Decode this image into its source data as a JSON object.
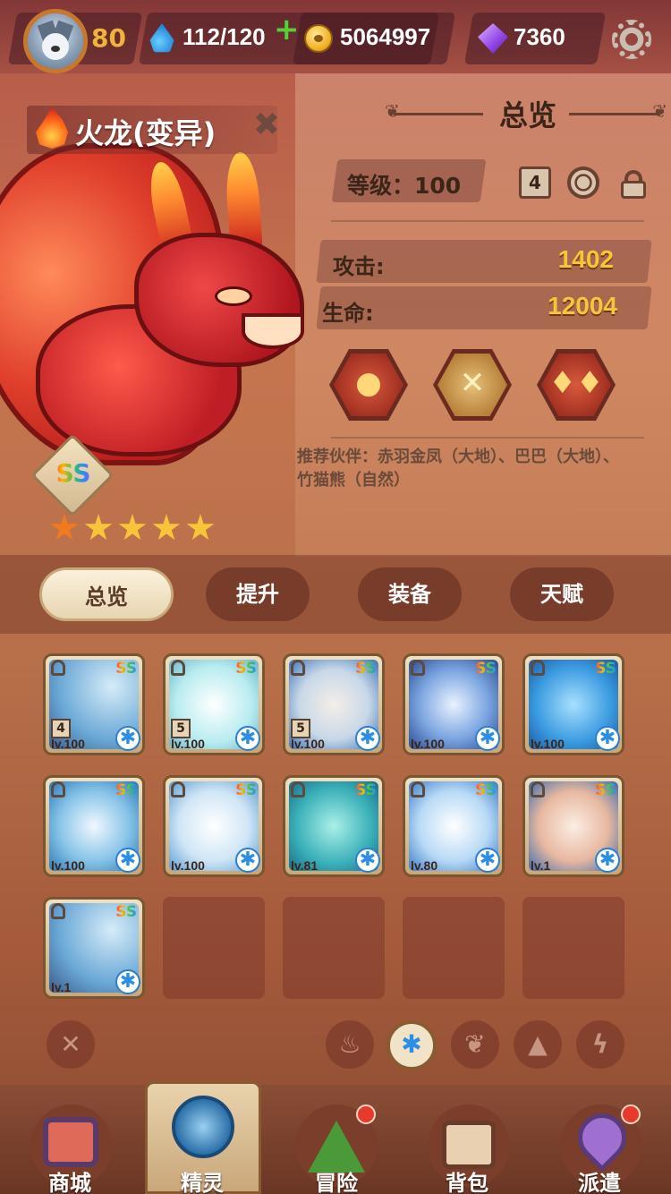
{
  "player": {
    "level": "80",
    "stamina": "112/120",
    "coins": "5064997",
    "gems": "7360"
  },
  "pet": {
    "name": "火龙(变异)",
    "rank": "SS",
    "stars": 5,
    "panel_title": "总览",
    "level_label": "等级：100",
    "chip_number": "4",
    "attack_label": "攻击:",
    "attack_value": "1402",
    "hp_label": "生命:",
    "hp_value": "12004",
    "partners": "推荐伙伴：赤羽金凤（大地）、巴巴（大地）、竹猫熊（自然）"
  },
  "tabs": [
    "总览",
    "提升",
    "装备",
    "天赋"
  ],
  "grid": [
    {
      "level": "lv.100",
      "rank": "SS",
      "num": "4"
    },
    {
      "level": "lv.100",
      "rank": "SS",
      "num": "5"
    },
    {
      "level": "lv.100",
      "rank": "SS",
      "num": "5"
    },
    {
      "level": "lv.100",
      "rank": "SS"
    },
    {
      "level": "lv.100",
      "rank": "SS"
    },
    {
      "level": "lv.100",
      "rank": "SS"
    },
    {
      "level": "lv.100",
      "rank": "SS"
    },
    {
      "level": "lv.81",
      "rank": "SS"
    },
    {
      "level": "lv.80",
      "rank": "SS"
    },
    {
      "level": "lv.1",
      "rank": "SS"
    },
    {
      "level": "lv.1",
      "rank": "SS"
    }
  ],
  "nav": {
    "shop": "商城",
    "pets": "精灵",
    "adventure": "冒险",
    "bag": "背包",
    "dispatch": "派遣"
  },
  "colors": {
    "gold": "#f7c53a",
    "ice": "#2a8ee4",
    "badge_red": "#e83a2a"
  },
  "icons": [
    "avatar-wolf",
    "water-drop",
    "plus",
    "coin",
    "gem",
    "gear",
    "flame",
    "close",
    "ring",
    "lock",
    "fire-orb",
    "crossed-swords",
    "twin-flame",
    "ice-snowflake",
    "leaf",
    "mountain",
    "lightning"
  ]
}
